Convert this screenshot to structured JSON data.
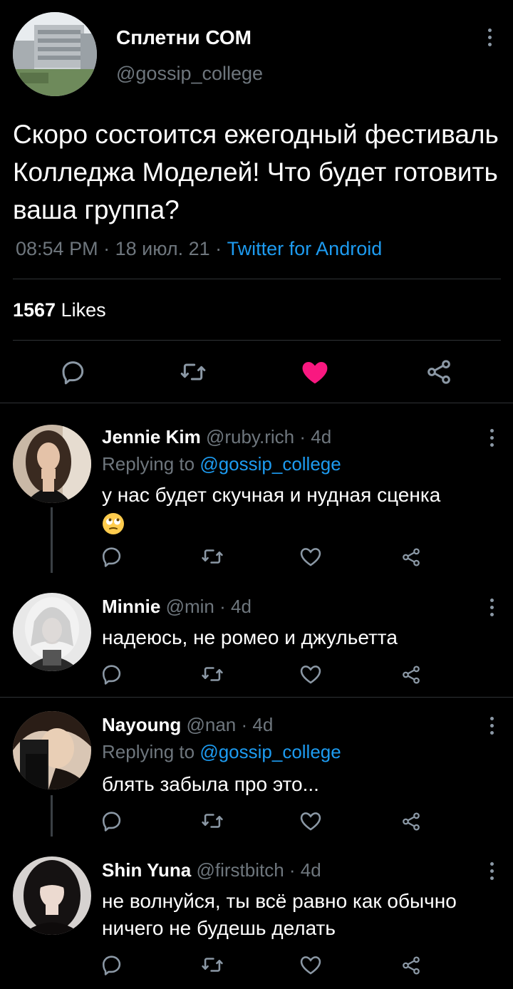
{
  "main_tweet": {
    "author_name": "Сплетни СОМ",
    "author_handle": "@gossip_college",
    "text": "Скоро состоится ежегодный фестиваль Колледжа Моделей! Что будет готовить ваша группа?",
    "time": "08:54 PM",
    "date": "18 июл. 21",
    "separator": " · ",
    "source": "Twitter for Android",
    "likes_count": "1567",
    "likes_label": "Likes",
    "liked": true
  },
  "replies": [
    {
      "name": "Jennie Kim",
      "handle": "@ruby.rich",
      "age": "4d",
      "replying_prefix": "Replying to ",
      "replying_to": "@gossip_college",
      "text": "у нас будет скучная и нудная сценка",
      "emoji": "face-with-rolling-eyes"
    },
    {
      "name": "Minnie",
      "handle": "@min",
      "age": "4d",
      "text": "надеюсь, не ромео и джульетта"
    },
    {
      "name": "Nayoung",
      "handle": "@nan",
      "age": "4d",
      "replying_prefix": "Replying to ",
      "replying_to": "@gossip_college",
      "text": "блять забыла про это..."
    },
    {
      "name": "Shin Yuna",
      "handle": "@firstbitch",
      "age": "4d",
      "text": "не волнуйся, ты всё равно как обычно ничего не будешь делать"
    }
  ],
  "dot": " · ",
  "colors": {
    "background": "#000000",
    "muted": "#6e767d",
    "link": "#1d9bf0",
    "like": "#f91880",
    "divider": "#2f3336"
  }
}
